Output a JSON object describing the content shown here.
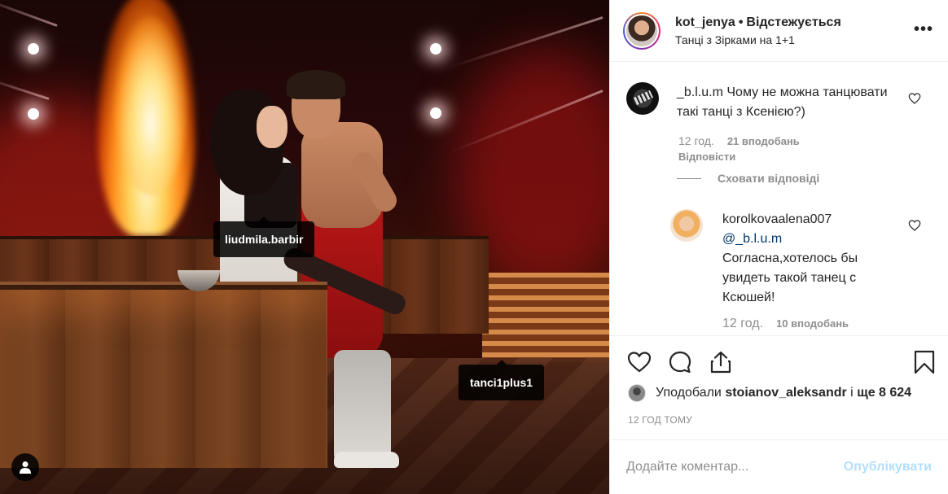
{
  "photo": {
    "tags": [
      "liudmila.barbir",
      "tanci1plus1"
    ],
    "user_tag_icon": "user-icon"
  },
  "header": {
    "username": "kot_jenya",
    "separator": "•",
    "follow_status": "Відстежується",
    "location": "Танці з Зірками на 1+1",
    "more_label": "•••"
  },
  "comments": [
    {
      "username": "_b.l.u.m",
      "text": "Чому не можна танцювати такі танці з Ксенією?)",
      "time": "12 год.",
      "likes": "21 вподобань",
      "reply_label": "Відповісти"
    }
  ],
  "hide_replies_label": "Сховати відповіді",
  "replies": [
    {
      "username": "korolkovaalena007",
      "mention": "@_b.l.u.m",
      "text": "Согласна,хотелось бы увидеть такой танец с Ксюшей!",
      "time": "12 год.",
      "likes": "10 вподобань"
    }
  ],
  "likes_summary": {
    "prefix": "Уподобали",
    "user": "stoianov_aleksandr",
    "middle": "і",
    "count": "ще 8 624"
  },
  "timestamp": "12 ГОД ТОМУ",
  "comment_box": {
    "placeholder": "Додайте коментар...",
    "publish_label": "Опублікувати"
  },
  "colors": {
    "text": "#262626",
    "muted": "#8e8e8e",
    "publish_disabled": "#b2dffc",
    "border": "#efefef"
  }
}
